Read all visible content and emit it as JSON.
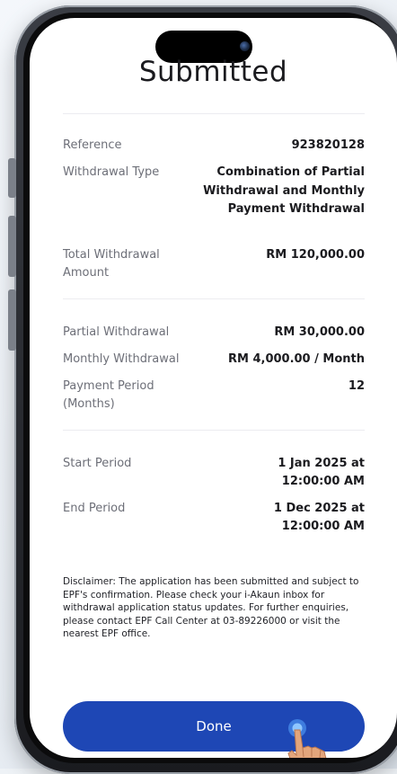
{
  "screen": {
    "title": "Submitted",
    "section1": {
      "reference_label": "Reference",
      "reference_value": "923820128",
      "withdrawal_type_label": "Withdrawal Type",
      "withdrawal_type_value": "Combination of Partial Withdrawal  and Monthly Payment Withdrawal",
      "total_amount_label": "Total Withdrawal Amount",
      "total_amount_value": "RM 120,000.00"
    },
    "section2": {
      "partial_label": "Partial Withdrawal",
      "partial_value": "RM 30,000.00",
      "monthly_label": "Monthly Withdrawal",
      "monthly_value": "RM 4,000.00 / Month",
      "period_label": "Payment Period (Months)",
      "period_value": "12"
    },
    "section3": {
      "start_label": "Start Period",
      "start_value": "1 Jan 2025 at 12:00:00 AM",
      "end_label": "End Period",
      "end_value": "1 Dec 2025 at 12:00:00 AM"
    },
    "disclaimer": "Disclaimer: The application has been submitted and subject to EPF's confirmation. Please check your i-Akaun inbox for withdrawal application status updates. For further enquiries, please contact EPF Call Center at 03-89226000 or visit the nearest EPF office.",
    "done_label": "Done"
  },
  "colors": {
    "primary_button": "#1e47b5",
    "title_text": "#1b1b1f",
    "label_text": "#6d6f78"
  },
  "icons": {
    "camera": "camera-icon",
    "tap_gesture": "tap-hand-icon"
  }
}
